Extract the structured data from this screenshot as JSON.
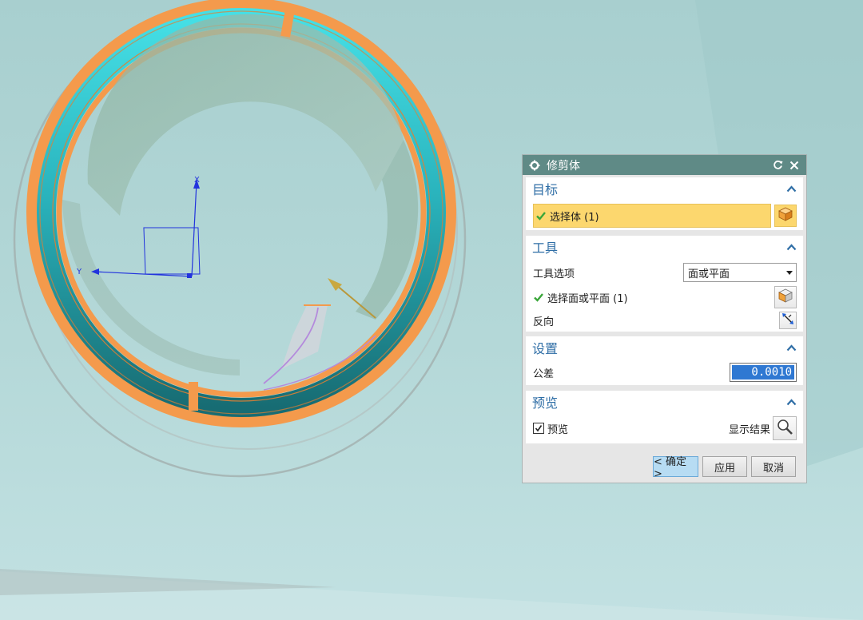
{
  "dialog": {
    "title": "修剪体",
    "sections": {
      "target": {
        "header": "目标",
        "select_body": "选择体 (1)"
      },
      "tool": {
        "header": "工具",
        "tool_option_label": "工具选项",
        "tool_option_value": "面或平面",
        "select_face": "选择面或平面 (1)",
        "reverse_label": "反向"
      },
      "settings": {
        "header": "设置",
        "tolerance_label": "公差",
        "tolerance_value": "0.0010"
      },
      "preview": {
        "header": "预览",
        "preview_checkbox_label": "预览",
        "preview_checked": true,
        "show_result_label": "显示结果"
      }
    },
    "buttons": {
      "ok": "< 确定 >",
      "apply": "应用",
      "cancel": "取消"
    }
  },
  "triad": {
    "x_label": "X",
    "y_label": "Y"
  },
  "colors": {
    "viewport_bg": "#b4d8d8",
    "ring_orange": "#f49a4c",
    "ring_cyan": "#39d6dd",
    "ring_teal": "#1f7f86",
    "titlebar": "#5f8a86",
    "section_header": "#2f6ea6",
    "selected_row": "#fcd76e",
    "check_green": "#3aa63a"
  }
}
